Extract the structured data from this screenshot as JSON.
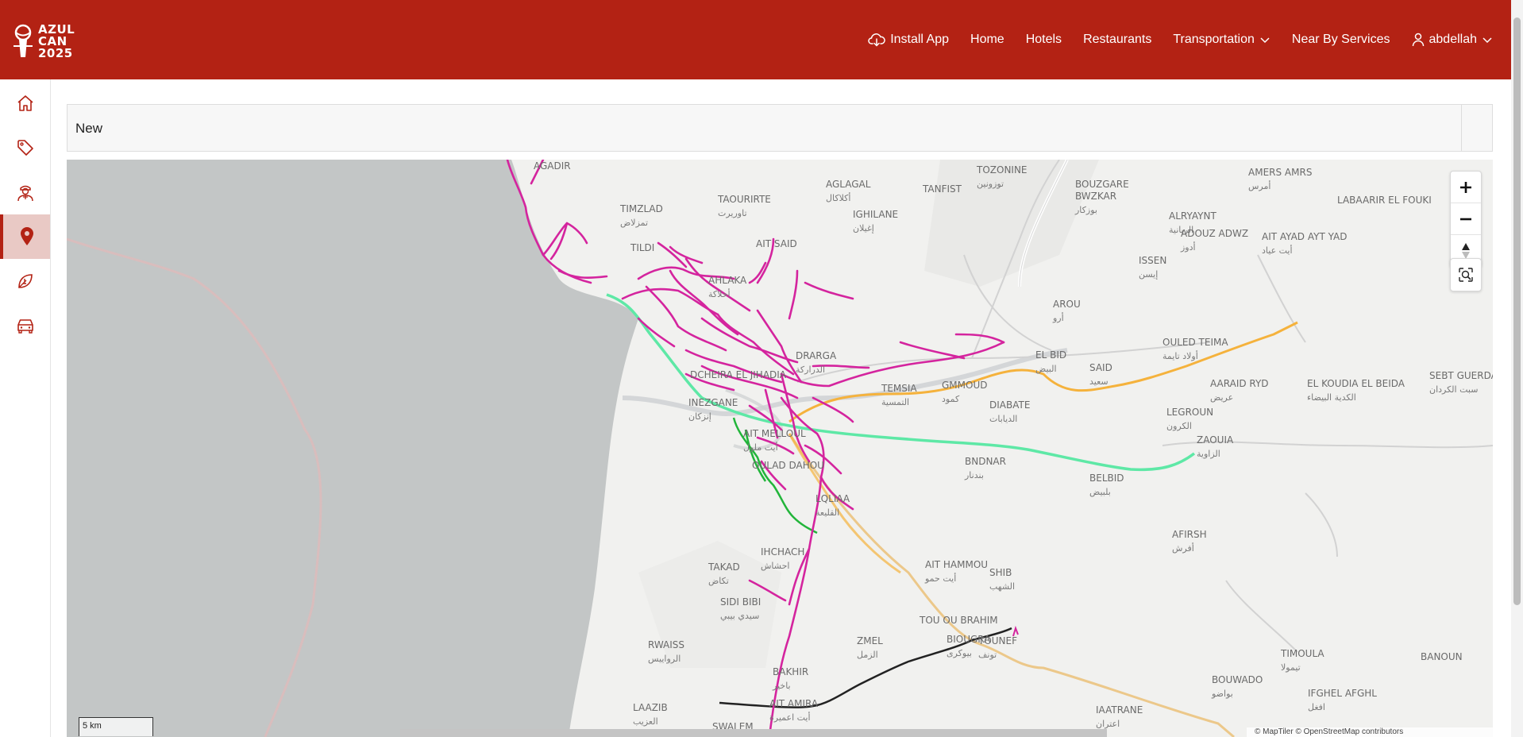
{
  "brand": {
    "logo_line1": "AZUL",
    "logo_line2": "CAN",
    "logo_line3": "2025"
  },
  "nav": {
    "install_app": "Install App",
    "home": "Home",
    "hotels": "Hotels",
    "restaurants": "Restaurants",
    "transportation": "Transportation",
    "nearby": "Near By Services",
    "user": "abdellah"
  },
  "sidebar": {
    "items": [
      {
        "icon": "home-icon"
      },
      {
        "icon": "tag-icon"
      },
      {
        "icon": "guide-icon"
      },
      {
        "icon": "map-pin-icon",
        "active": true
      },
      {
        "icon": "leaf-icon"
      },
      {
        "icon": "car-icon"
      }
    ]
  },
  "panel": {
    "title": "New"
  },
  "map": {
    "scale": "5 km",
    "attribution": "© MapTiler © OpenStreetMap contributors",
    "colors": {
      "magenta": "#d4249e",
      "mint": "#5ee8a6",
      "green": "#22b53a",
      "orange": "#f5b23c",
      "sand": "#e8c98a",
      "black": "#222222",
      "sea": "#c3c6c6",
      "land": "#f1f1ef"
    },
    "places": [
      {
        "latin": "AGADIR",
        "arabic": ""
      },
      {
        "latin": "TIMZLAD",
        "arabic": "تمزلاض"
      },
      {
        "latin": "TAOURIRTE",
        "arabic": "تاوريرت"
      },
      {
        "latin": "AGLAGAL",
        "arabic": "أكلاكال"
      },
      {
        "latin": "TANFIST",
        "arabic": ""
      },
      {
        "latin": "TOZONINE",
        "arabic": "توزونين"
      },
      {
        "latin": "BOUZGARE",
        "arabic": ""
      },
      {
        "latin": "BWZKAR",
        "arabic": "بوزكار"
      },
      {
        "latin": "AMERS AMRS",
        "arabic": "أمرس"
      },
      {
        "latin": "LABAARIR EL FOUKI",
        "arabic": ""
      },
      {
        "latin": "IGHILANE",
        "arabic": "إغيلان"
      },
      {
        "latin": "ALRYAYNT",
        "arabic": "الريانية"
      },
      {
        "latin": "ADOUZ ADWZ",
        "arabic": "أدوز"
      },
      {
        "latin": "AIT AYAD AYT YAD",
        "arabic": "أيت عياد"
      },
      {
        "latin": "TILDI",
        "arabic": ""
      },
      {
        "latin": "AIT SAID",
        "arabic": ""
      },
      {
        "latin": "ISSEN",
        "arabic": "إيسن"
      },
      {
        "latin": "AHLAKA",
        "arabic": "أحلاكة"
      },
      {
        "latin": "AROU",
        "arabic": "أرو"
      },
      {
        "latin": "OULED TEIMA",
        "arabic": "أولاد تايمة"
      },
      {
        "latin": "EL BID",
        "arabic": "البيض"
      },
      {
        "latin": "SAID",
        "arabic": "سعيد"
      },
      {
        "latin": "AARAID RYD",
        "arabic": "عريض"
      },
      {
        "latin": "EL KOUDIA EL BEIDA",
        "arabic": "الكدية البيضاء"
      },
      {
        "latin": "SEBT GUERDANE",
        "arabic": "سبت الكردان"
      },
      {
        "latin": "DCHEIRA EL JIHADIA",
        "arabic": ""
      },
      {
        "latin": "DRARGA",
        "arabic": "الدراركة"
      },
      {
        "latin": "TEMSIA",
        "arabic": "التمسية"
      },
      {
        "latin": "GMMOUD",
        "arabic": "كمود"
      },
      {
        "latin": "DIABATE",
        "arabic": "الديابات"
      },
      {
        "latin": "LEGROUN",
        "arabic": "الكرون"
      },
      {
        "latin": "INEZGANE",
        "arabic": "إنزكان"
      },
      {
        "latin": "AIT MELLOUL",
        "arabic": "أيت ملول"
      },
      {
        "latin": "ZAOUIA",
        "arabic": "الزاوية"
      },
      {
        "latin": "BNDNAR",
        "arabic": "بندنار"
      },
      {
        "latin": "BELBID",
        "arabic": "بلبيض"
      },
      {
        "latin": "OULAD DAHOU",
        "arabic": ""
      },
      {
        "latin": "LQLIAA",
        "arabic": "القليعة"
      },
      {
        "latin": "AFIRSH",
        "arabic": "أفرش"
      },
      {
        "latin": "IHCHACH",
        "arabic": "احشاش"
      },
      {
        "latin": "TAKAD",
        "arabic": "تكاض"
      },
      {
        "latin": "AIT HAMMOU",
        "arabic": "أيت حمو"
      },
      {
        "latin": "SHIB",
        "arabic": "الشهب"
      },
      {
        "latin": "SIDI BIBI",
        "arabic": "سيدي بيبي"
      },
      {
        "latin": "TOU OU BRAHIM",
        "arabic": ""
      },
      {
        "latin": "BIOUGRA",
        "arabic": "بيوكرى"
      },
      {
        "latin": "TOUNEF",
        "arabic": "تونف"
      },
      {
        "latin": "RWAISS",
        "arabic": "الرواييس"
      },
      {
        "latin": "ZMEL",
        "arabic": "الزمل"
      },
      {
        "latin": "TIMOULA",
        "arabic": "تيمولا"
      },
      {
        "latin": "BANOUN",
        "arabic": ""
      },
      {
        "latin": "BAKHIR",
        "arabic": "باخير"
      },
      {
        "latin": "BOUWADO",
        "arabic": "بواضو"
      },
      {
        "latin": "AIT AMIRA",
        "arabic": "أيت اعميرة"
      },
      {
        "latin": "IFGHEL AFGHL",
        "arabic": "افغل"
      },
      {
        "latin": "LAAZIB",
        "arabic": "العزيب"
      },
      {
        "latin": "IAATRANE",
        "arabic": "اعتران"
      },
      {
        "latin": "SWALEM",
        "arabic": ""
      }
    ]
  }
}
